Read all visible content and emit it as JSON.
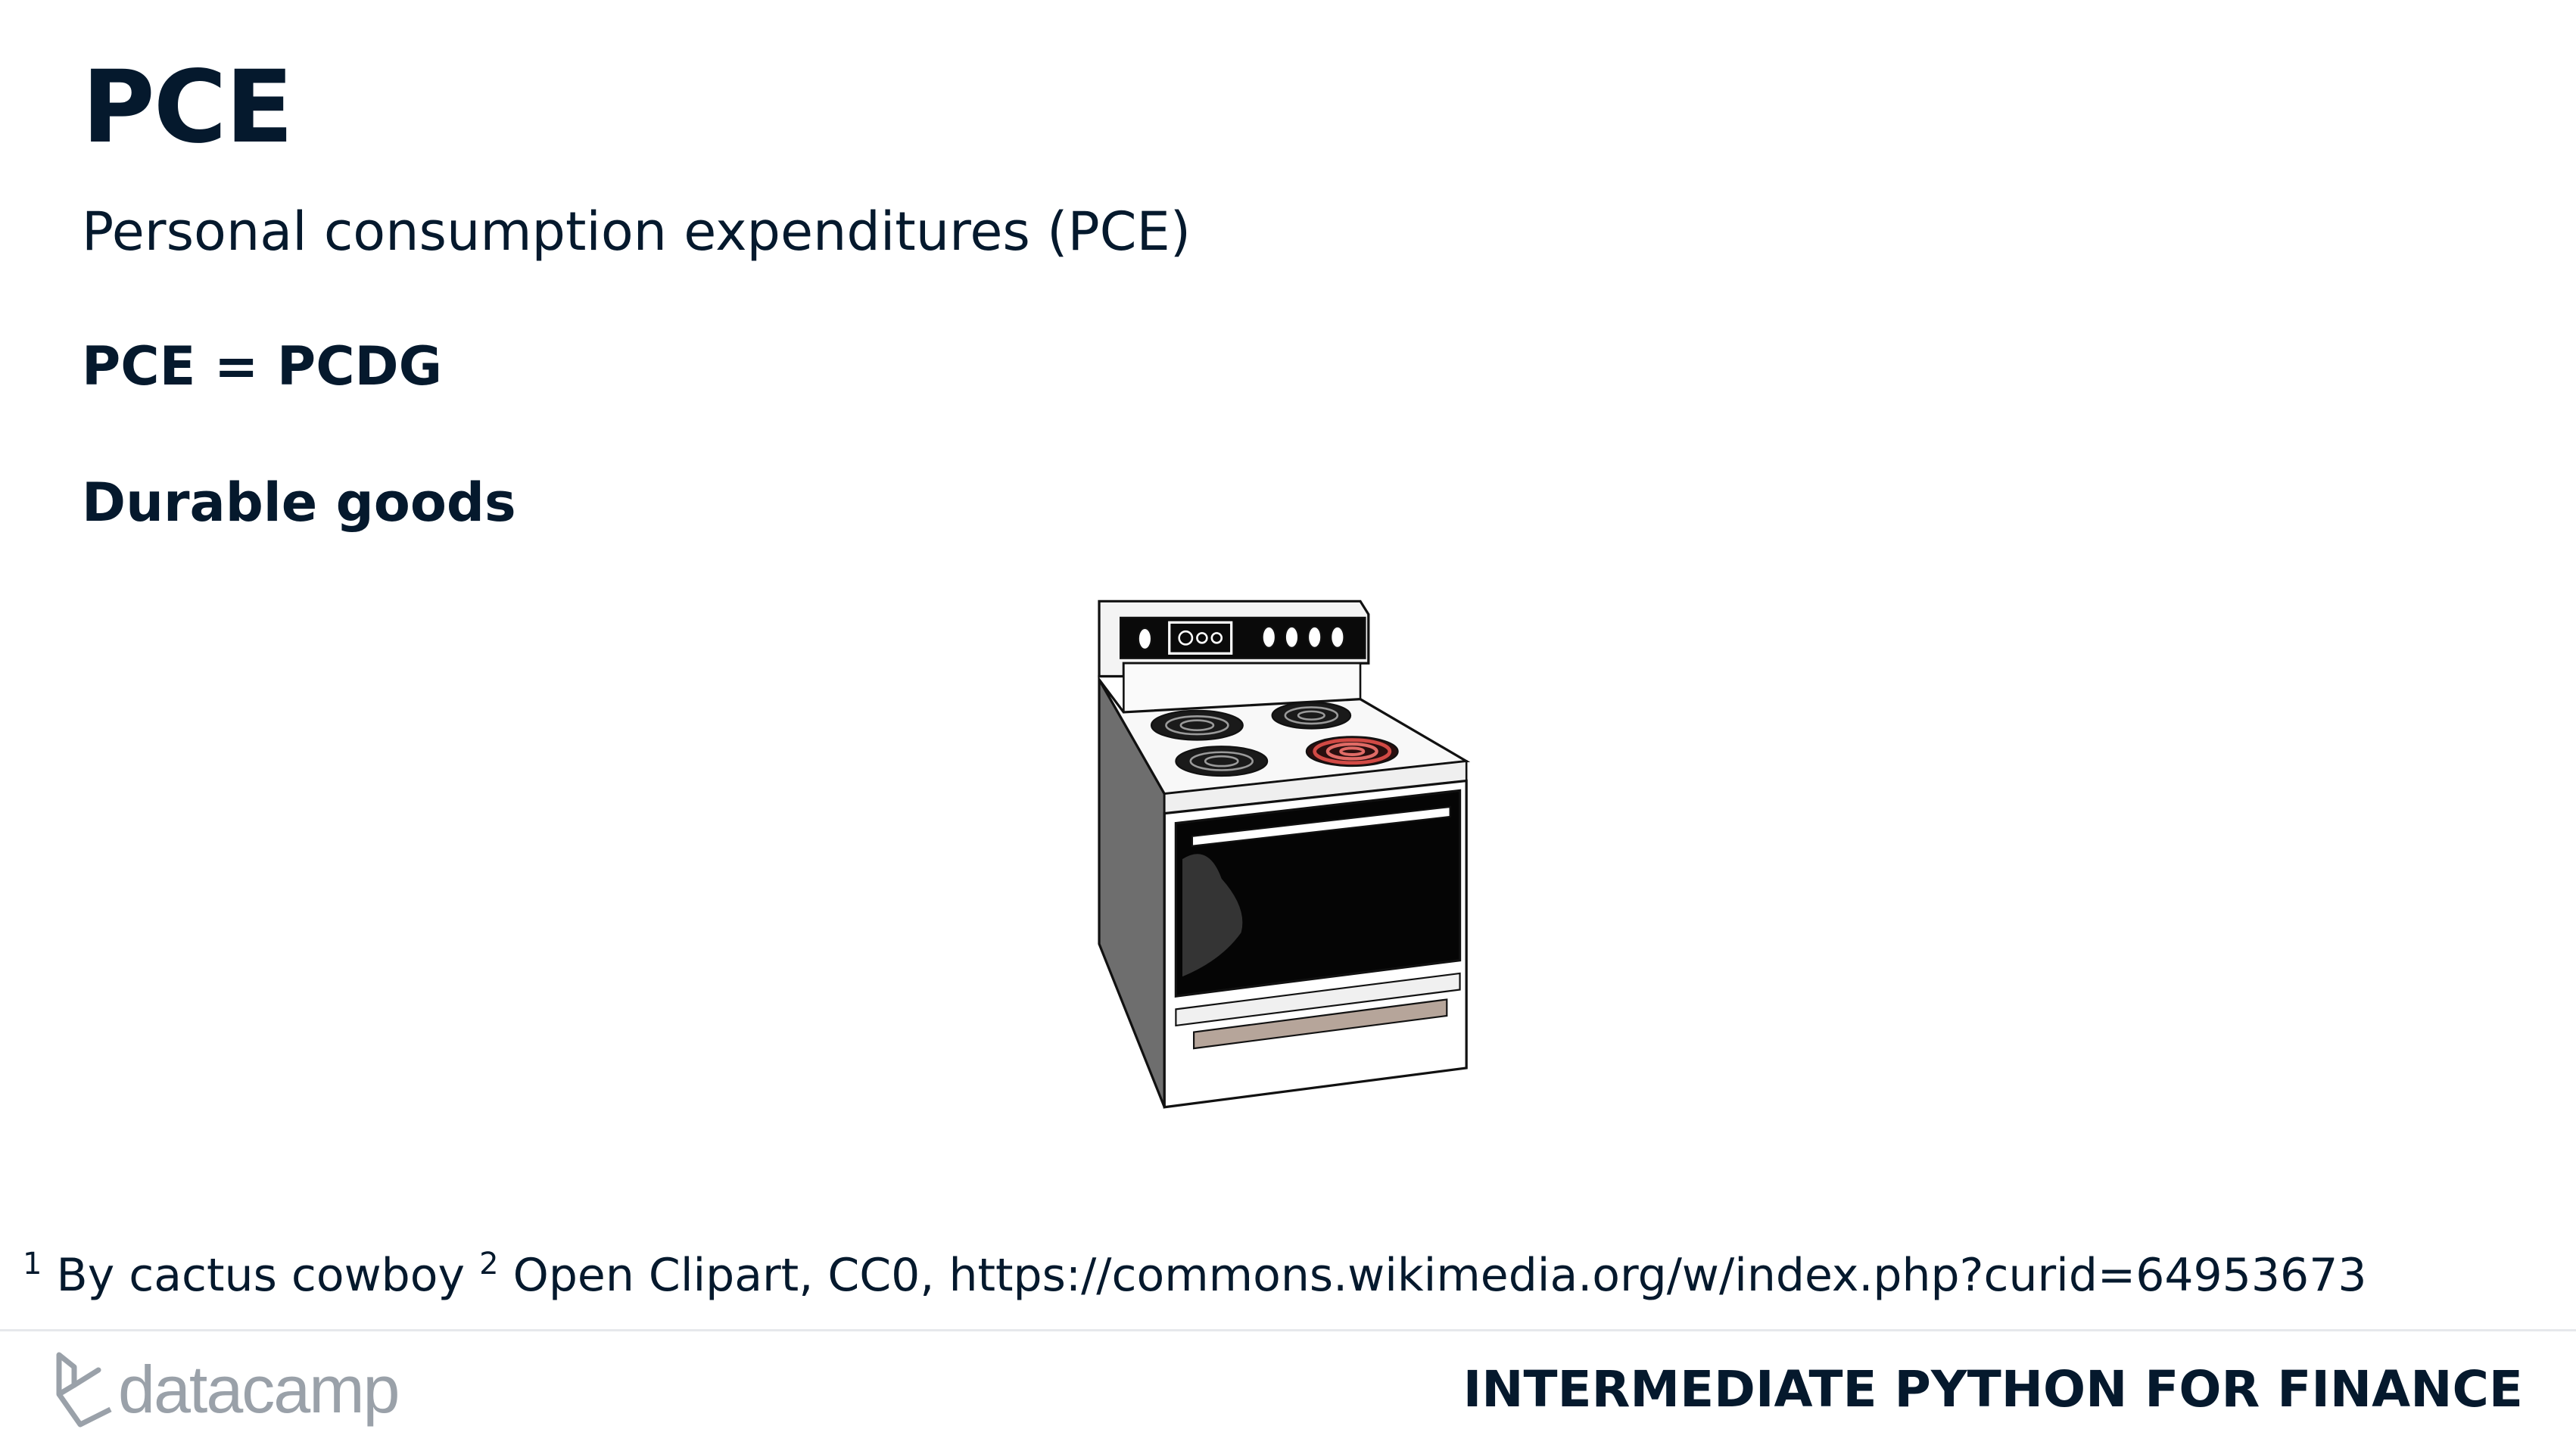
{
  "slide": {
    "title": "PCE",
    "subtitle": "Personal consumption expenditures (PCE)",
    "equation": "PCE = PCDG",
    "section_heading": "Durable goods"
  },
  "footnote": {
    "marker_1": "1",
    "text_1": "By cactus cowboy",
    "marker_2": "2",
    "text_2": "Open Clipart, CC0, https://commons.wikimedia.org/w/index.php?curid=64953673"
  },
  "footer": {
    "logo_text": "datacamp",
    "course_title": "INTERMEDIATE PYTHON FOR FINANCE"
  },
  "image": {
    "icon": "electric-stove-illustration",
    "active_burner_color": "#d24a45"
  },
  "colors": {
    "text": "#05192d",
    "logo_gray": "#9aa1a9",
    "divider": "#e6e8eb"
  }
}
